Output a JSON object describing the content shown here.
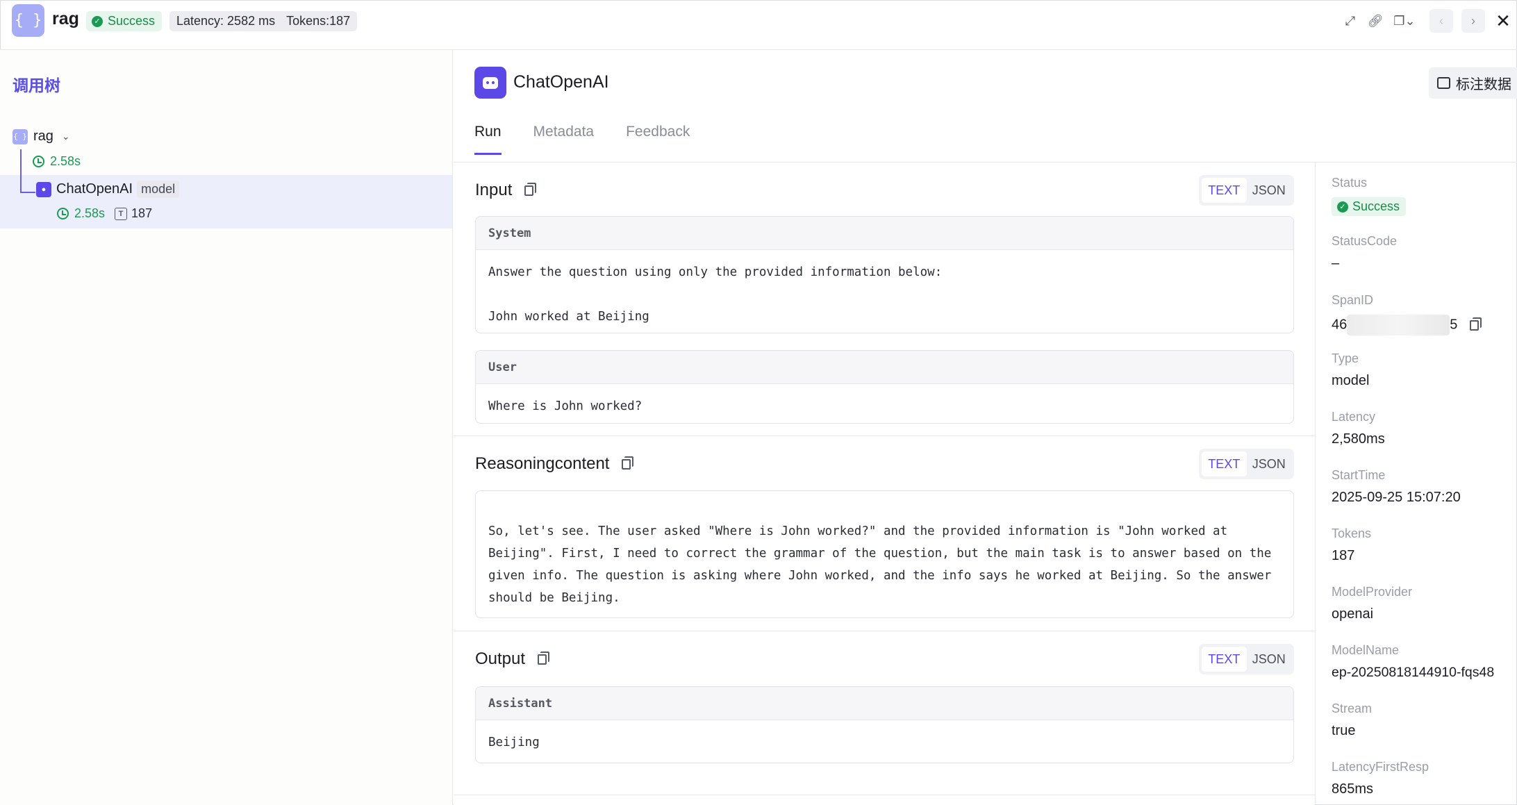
{
  "header": {
    "app_icon": "{ }",
    "title": "rag",
    "status": "Success",
    "latency": "Latency: 2582 ms",
    "tokens": "Tokens:187",
    "icons": [
      "expand-icon",
      "link-icon",
      "copy-dropdown-icon",
      "prev-icon",
      "next-icon",
      "close-icon"
    ]
  },
  "tree": {
    "title": "调用树",
    "root": {
      "icon": "{ }",
      "label": "rag",
      "time": "2.58s"
    },
    "child": {
      "label": "ChatOpenAI",
      "tag": "model",
      "time": "2.58s",
      "tokens": "187",
      "token_icon": "T"
    }
  },
  "detail": {
    "title": "ChatOpenAI",
    "annotate_label": "标注数据",
    "tabs": [
      "Run",
      "Metadata",
      "Feedback"
    ]
  },
  "sections": {
    "input": {
      "title": "Input",
      "toggle": [
        "TEXT",
        "JSON"
      ],
      "system_role": "System",
      "system_text": "Answer the question using only the provided information below:\n\nJohn worked at Beijing",
      "user_role": "User",
      "user_text": "Where is John worked?"
    },
    "reasoning": {
      "title": "Reasoningcontent",
      "toggle": [
        "TEXT",
        "JSON"
      ],
      "text": "So, let's see. The user asked \"Where is John worked?\" and the provided information is \"John worked at\nBeijing\". First, I need to correct the grammar of the question, but the main task is to answer based on the\ngiven info. The question is asking where John worked, and the info says he worked at Beijing. So the answer\nshould be Beijing."
    },
    "output": {
      "title": "Output",
      "toggle": [
        "TEXT",
        "JSON"
      ],
      "role": "Assistant",
      "text": "Beijing"
    }
  },
  "info": {
    "status_label": "Status",
    "status_value": "Success",
    "statuscode_label": "StatusCode",
    "statuscode_value": "–",
    "spanid_label": "SpanID",
    "spanid_prefix": "46",
    "spanid_suffix": "5",
    "type_label": "Type",
    "type_value": "model",
    "latency_label": "Latency",
    "latency_value": "2,580ms",
    "starttime_label": "StartTime",
    "starttime_value": "2025-09-25 15:07:20",
    "tokens_label": "Tokens",
    "tokens_value": "187",
    "provider_label": "ModelProvider",
    "provider_value": "openai",
    "modelname_label": "ModelName",
    "modelname_value": "ep-20250818144910-fqs48",
    "stream_label": "Stream",
    "stream_value": "true",
    "firstresp_label": "LatencyFirstResp",
    "firstresp_value": "865ms"
  },
  "colors": {
    "accent": "#5b48e6",
    "success": "#1a9a52",
    "tree_title": "#5a4fe0"
  }
}
